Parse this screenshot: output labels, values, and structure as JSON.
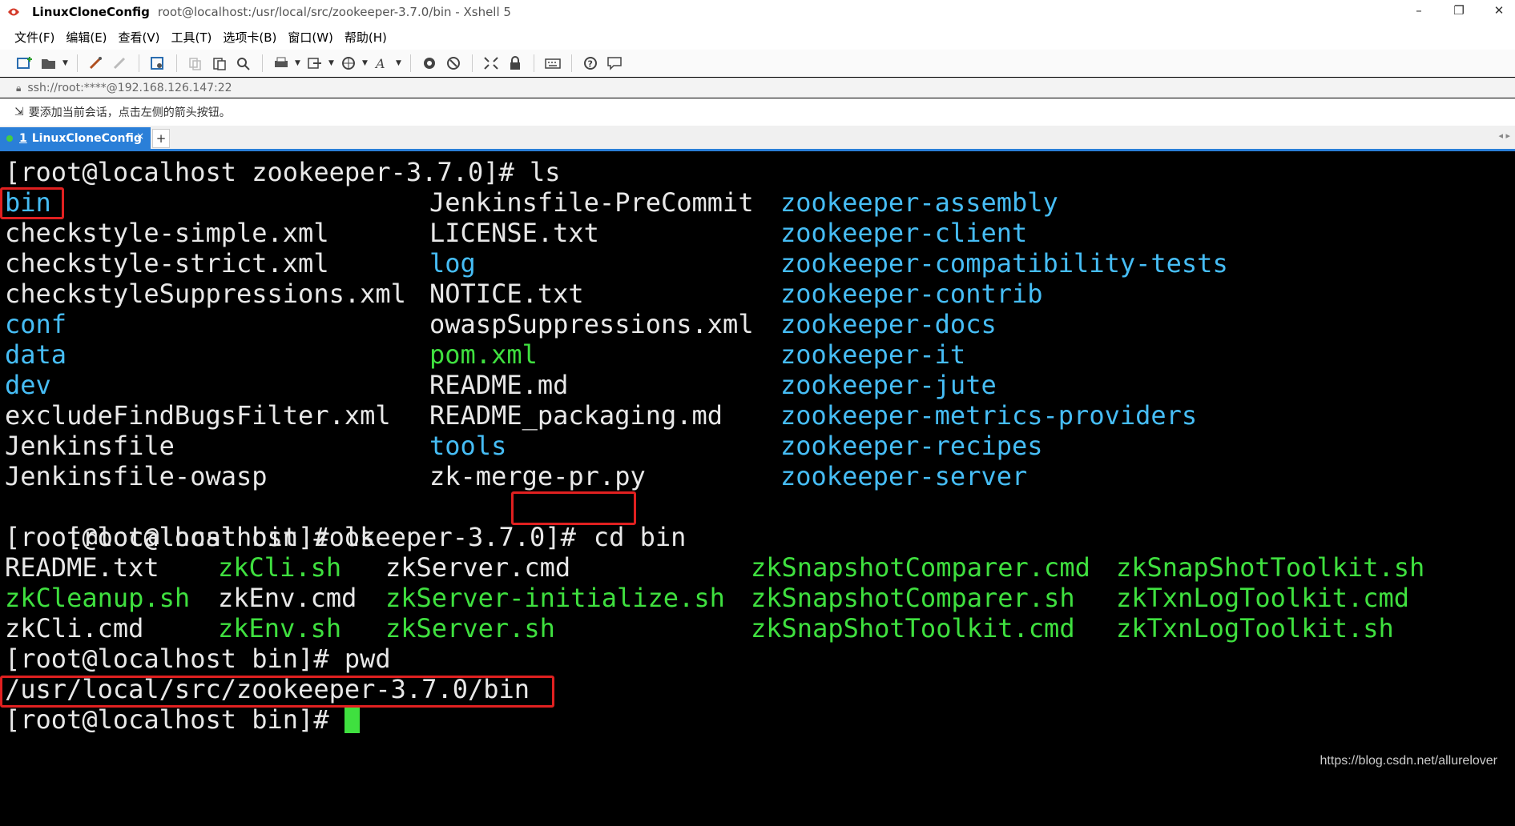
{
  "window": {
    "app_name": "LinuxCloneConfig",
    "title_path": "root@localhost:/usr/local/src/zookeeper-3.7.0/bin - Xshell 5",
    "controls": [
      "–",
      "❐",
      "✕"
    ]
  },
  "menu": [
    "文件(F)",
    "编辑(E)",
    "查看(V)",
    "工具(T)",
    "选项卡(B)",
    "窗口(W)",
    "帮助(H)"
  ],
  "toolbar_icons": [
    "new-session-icon",
    "open-folder-icon",
    "reconnect-icon",
    "disconnect-icon",
    "properties-icon",
    "copy-icon",
    "paste-icon",
    "find-icon",
    "print-icon",
    "transfer-icon",
    "globe-icon",
    "font-icon",
    "xftp-icon",
    "xshell-icon",
    "fullscreen-icon",
    "lock-icon",
    "keyboard-icon",
    "help-icon",
    "comment-icon"
  ],
  "address": {
    "value": "ssh://root:****@192.168.126.147:22"
  },
  "hint": {
    "text": "要添加当前会话，点击左侧的箭头按钮。"
  },
  "tabs": [
    {
      "number": "1",
      "label": "LinuxCloneConfig",
      "close": "×"
    }
  ],
  "tab_add": "+",
  "tab_nav": "◂ ▸",
  "terminal": {
    "prompt1": "[root@localhost zookeeper-3.7.0]# ls",
    "listing1": {
      "col1": [
        {
          "name": "bin",
          "kind": "dir"
        },
        {
          "name": "checkstyle-simple.xml",
          "kind": "plain"
        },
        {
          "name": "checkstyle-strict.xml",
          "kind": "plain"
        },
        {
          "name": "checkstyleSuppressions.xml",
          "kind": "plain"
        },
        {
          "name": "conf",
          "kind": "dir"
        },
        {
          "name": "data",
          "kind": "dir"
        },
        {
          "name": "dev",
          "kind": "dir"
        },
        {
          "name": "excludeFindBugsFilter.xml",
          "kind": "plain"
        },
        {
          "name": "Jenkinsfile",
          "kind": "plain"
        },
        {
          "name": "Jenkinsfile-owasp",
          "kind": "plain"
        }
      ],
      "col2": [
        {
          "name": "Jenkinsfile-PreCommit",
          "kind": "plain"
        },
        {
          "name": "LICENSE.txt",
          "kind": "plain"
        },
        {
          "name": "log",
          "kind": "dir"
        },
        {
          "name": "NOTICE.txt",
          "kind": "plain"
        },
        {
          "name": "owaspSuppressions.xml",
          "kind": "plain"
        },
        {
          "name": "pom.xml",
          "kind": "exe"
        },
        {
          "name": "README.md",
          "kind": "plain"
        },
        {
          "name": "README_packaging.md",
          "kind": "plain"
        },
        {
          "name": "tools",
          "kind": "dir"
        },
        {
          "name": "zk-merge-pr.py",
          "kind": "plain"
        }
      ],
      "col3": [
        {
          "name": "zookeeper-assembly",
          "kind": "dir"
        },
        {
          "name": "zookeeper-client",
          "kind": "dir"
        },
        {
          "name": "zookeeper-compatibility-tests",
          "kind": "dir"
        },
        {
          "name": "zookeeper-contrib",
          "kind": "dir"
        },
        {
          "name": "zookeeper-docs",
          "kind": "dir"
        },
        {
          "name": "zookeeper-it",
          "kind": "dir"
        },
        {
          "name": "zookeeper-jute",
          "kind": "dir"
        },
        {
          "name": "zookeeper-metrics-providers",
          "kind": "dir"
        },
        {
          "name": "zookeeper-recipes",
          "kind": "dir"
        },
        {
          "name": "zookeeper-server",
          "kind": "dir"
        }
      ]
    },
    "prompt2": "[root@localhost zookeeper-3.7.0]#",
    "cmd2": "cd bin",
    "prompt3": "[root@localhost bin]# ls",
    "listing2": {
      "col1": [
        {
          "name": "README.txt",
          "kind": "plain"
        },
        {
          "name": "zkCleanup.sh",
          "kind": "exe"
        },
        {
          "name": "zkCli.cmd",
          "kind": "plain"
        }
      ],
      "col2": [
        {
          "name": "zkCli.sh",
          "kind": "exe"
        },
        {
          "name": "zkEnv.cmd",
          "kind": "plain"
        },
        {
          "name": "zkEnv.sh",
          "kind": "exe"
        }
      ],
      "col3": [
        {
          "name": "zkServer.cmd",
          "kind": "plain"
        },
        {
          "name": "zkServer-initialize.sh",
          "kind": "exe"
        },
        {
          "name": "zkServer.sh",
          "kind": "exe"
        }
      ],
      "col4": [
        {
          "name": "zkSnapshotComparer.cmd",
          "kind": "exe"
        },
        {
          "name": "zkSnapshotComparer.sh",
          "kind": "exe"
        },
        {
          "name": "zkSnapShotToolkit.cmd",
          "kind": "exe"
        }
      ],
      "col5": [
        {
          "name": "zkSnapShotToolkit.sh",
          "kind": "exe"
        },
        {
          "name": "zkTxnLogToolkit.cmd",
          "kind": "exe"
        },
        {
          "name": "zkTxnLogToolkit.sh",
          "kind": "exe"
        }
      ]
    },
    "prompt4": "[root@localhost bin]# pwd",
    "pwd_output": "/usr/local/src/zookeeper-3.7.0/bin",
    "prompt5": "[root@localhost bin]# ",
    "colors": {
      "dir": "#46bdf5",
      "exe": "#3fe03f",
      "plain": "#e8e8e8",
      "highlight": "#e02020"
    }
  },
  "watermark": "https://blog.csdn.net/allurelover"
}
